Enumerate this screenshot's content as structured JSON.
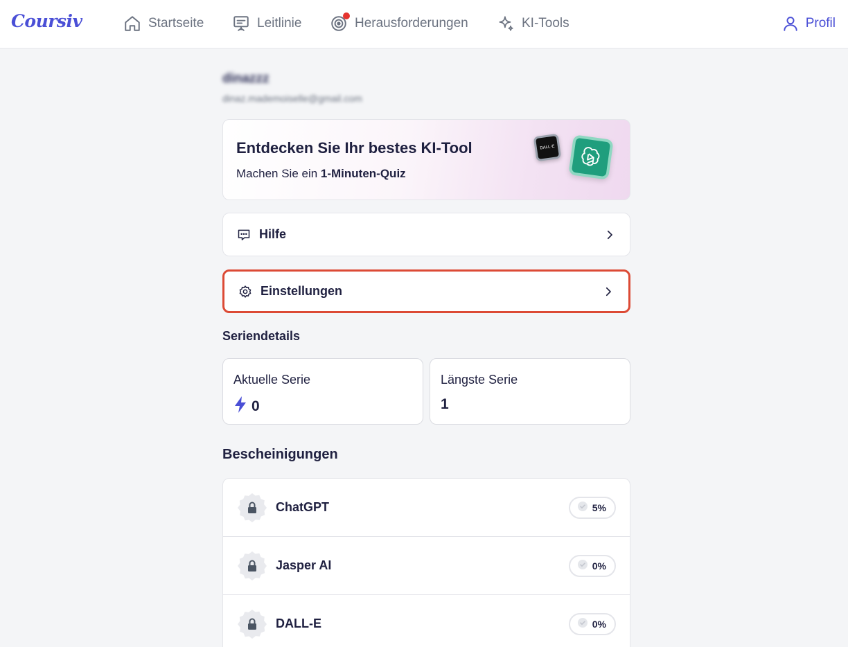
{
  "app": {
    "logo": "Coursiv"
  },
  "nav": {
    "items": [
      {
        "label": "Startseite",
        "icon": "home-icon"
      },
      {
        "label": "Leitlinie",
        "icon": "presentation-icon"
      },
      {
        "label": "Herausforderungen",
        "icon": "target-icon",
        "has_notification": true
      },
      {
        "label": "KI-Tools",
        "icon": "sparkle-icon"
      }
    ],
    "profile": {
      "label": "Profil",
      "icon": "user-icon"
    }
  },
  "user": {
    "name": "dinazzz",
    "email": "dinaz.mademoiselle@gmail.com"
  },
  "promo": {
    "title": "Entdecken Sie Ihr bestes KI-Tool",
    "subtitle_prefix": "Machen Sie ein ",
    "subtitle_bold": "1-Minuten-Quiz",
    "dalle_badge": "DALL·E"
  },
  "menu": {
    "help": {
      "label": "Hilfe",
      "icon": "chat-help-icon"
    },
    "settings": {
      "label": "Einstellungen",
      "icon": "gear-icon",
      "highlighted": true
    }
  },
  "streaks": {
    "title": "Seriendetails",
    "current": {
      "label": "Aktuelle Serie",
      "value": "0",
      "icon": "lightning-icon"
    },
    "longest": {
      "label": "Längste Serie",
      "value": "1"
    }
  },
  "certificates": {
    "title": "Bescheinigungen",
    "items": [
      {
        "name": "ChatGPT",
        "progress": "5%",
        "locked": true
      },
      {
        "name": "Jasper AI",
        "progress": "0%",
        "locked": true
      },
      {
        "name": "DALL-E",
        "progress": "0%",
        "locked": true
      }
    ]
  },
  "colors": {
    "accent": "#4a4fd6",
    "highlight_border": "#dc4a35",
    "notification": "#e5342f",
    "text": "#1f2040",
    "muted": "#6b7280",
    "background": "#f4f5f7"
  }
}
